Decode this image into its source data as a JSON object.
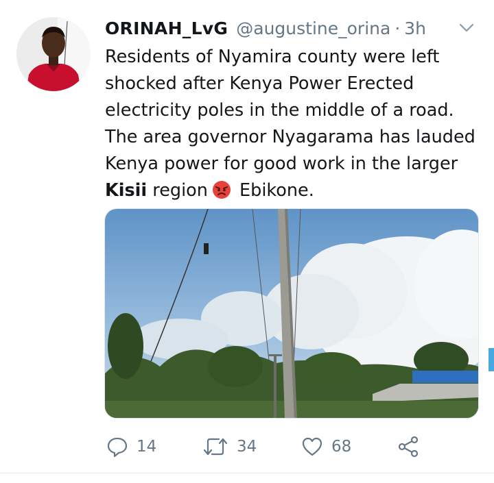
{
  "tweet": {
    "display_name": "ORINAH_LvG",
    "handle": "@augustine_orina",
    "separator": "·",
    "time": "3h",
    "text_part1": "Residents of Nyamira county were left shocked after Kenya Power Erected electricity poles in the middle of a road. The area governor Nyagarama has lauded Kenya power for good work in the larger ",
    "text_bold": "Kisii",
    "text_part2": " region",
    "text_part3": " Ebikone.",
    "emoji": "angry-face",
    "media_alt": "Electricity pole standing in the middle of a road under a cloudy sky"
  },
  "actions": {
    "reply_count": "14",
    "retweet_count": "34",
    "like_count": "68"
  },
  "colors": {
    "text": "#14171a",
    "secondary": "#657786",
    "accent": "#4aa8e0"
  }
}
